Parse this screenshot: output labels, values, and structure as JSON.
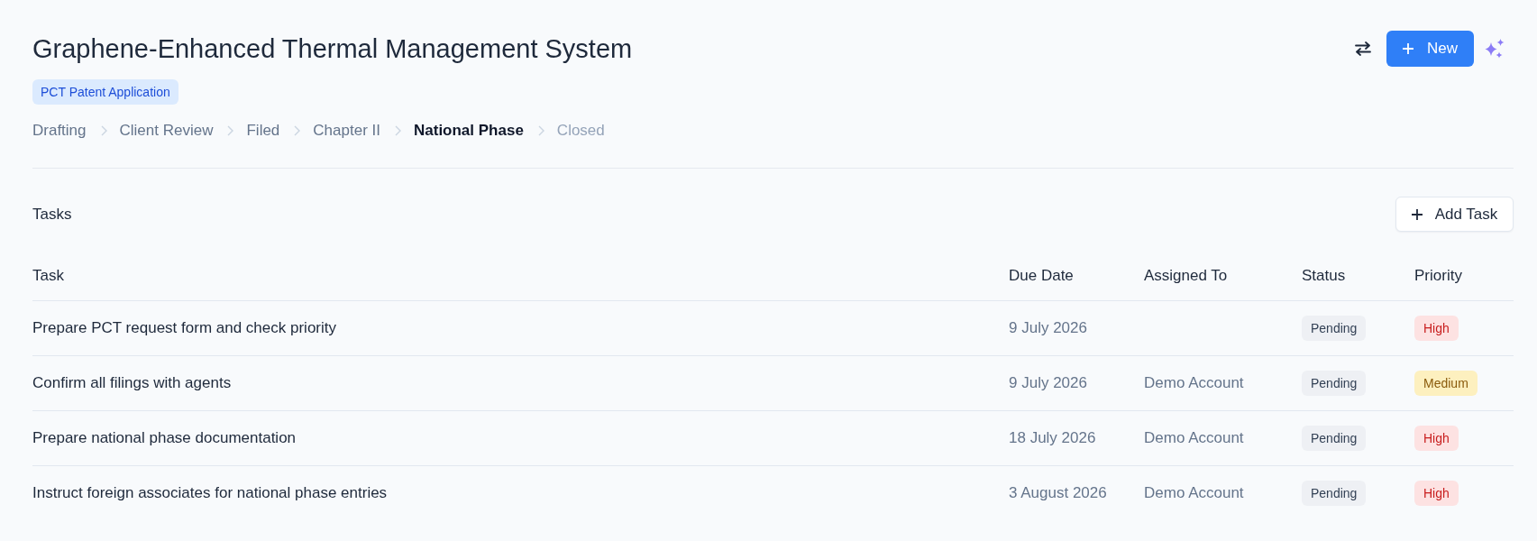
{
  "header": {
    "title": "Graphene-Enhanced Thermal Management System",
    "new_button": "New",
    "badge": "PCT Patent Application",
    "stages": [
      {
        "label": "Drafting",
        "completed": true,
        "selected": false
      },
      {
        "label": "Client Review",
        "completed": true,
        "selected": false
      },
      {
        "label": "Filed",
        "completed": true,
        "selected": false
      },
      {
        "label": "Chapter II",
        "completed": true,
        "selected": false
      },
      {
        "label": "National Phase",
        "completed": false,
        "selected": true
      },
      {
        "label": "Closed",
        "completed": false,
        "selected": false
      }
    ]
  },
  "tasks": {
    "title": "Tasks",
    "add_button": "Add Task",
    "columns": [
      "Task",
      "Due Date",
      "Assigned To",
      "Status",
      "Priority"
    ],
    "rows": [
      {
        "task": "Prepare PCT request form and check priority",
        "due_date": "9 July 2026",
        "status": {
          "text": "Pending",
          "kind": "pending"
        },
        "priority": {
          "text": "High",
          "kind": "high"
        }
      },
      {
        "task": "Confirm all filings with agents",
        "due_date": "9 July 2026",
        "assigned_to": "Demo Account",
        "status": {
          "text": "Pending",
          "kind": "pending"
        },
        "priority": {
          "text": "Medium",
          "kind": "medium"
        }
      },
      {
        "task": "Prepare national phase documentation",
        "due_date": "18 July 2026",
        "assigned_to": "Demo Account",
        "status": {
          "text": "Pending",
          "kind": "pending"
        },
        "priority": {
          "text": "High",
          "kind": "high"
        }
      },
      {
        "task": "Instruct foreign associates for national phase entries",
        "due_date": "3 August 2026",
        "assigned_to": "Demo Account",
        "status": {
          "text": "Pending",
          "kind": "pending"
        },
        "priority": {
          "text": "High",
          "kind": "high"
        }
      }
    ]
  }
}
